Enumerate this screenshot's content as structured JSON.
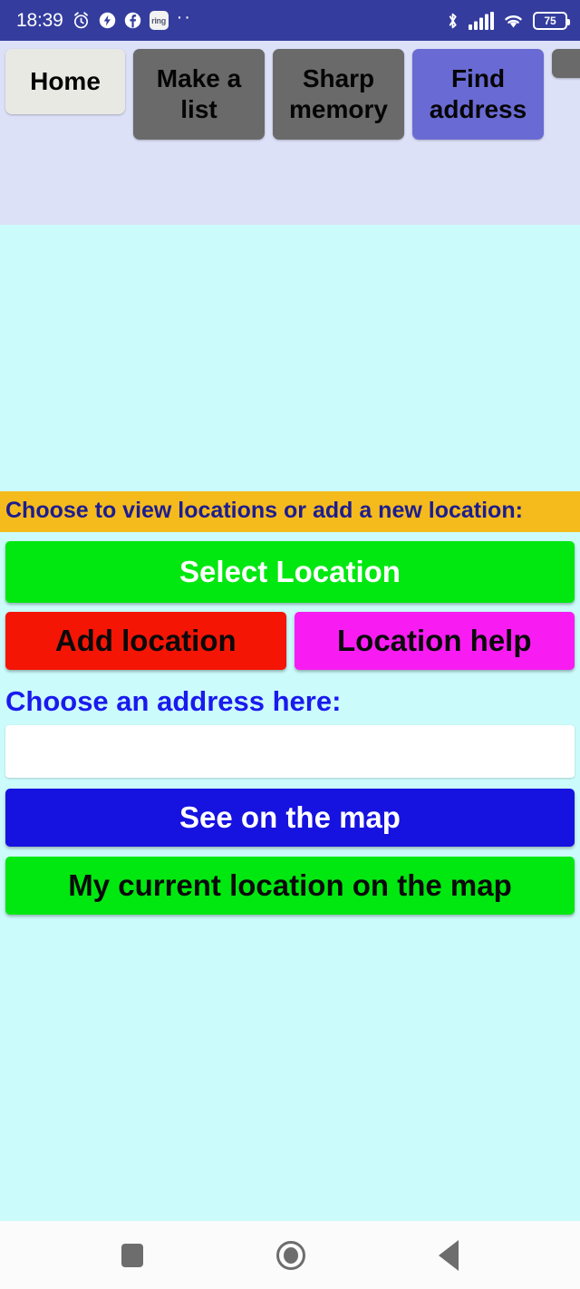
{
  "status_bar": {
    "time": "18:39",
    "left_icons": [
      {
        "name": "alarm-clock-icon"
      },
      {
        "name": "power-saver-bolt-icon"
      },
      {
        "name": "facebook-icon"
      },
      {
        "name": "ring-app-icon",
        "label": "ring"
      },
      {
        "name": "more-notifications-icon",
        "label": "··"
      }
    ],
    "right_icons": [
      {
        "name": "bluetooth-icon"
      },
      {
        "name": "cellular-signal-icon"
      },
      {
        "name": "wifi-icon"
      }
    ],
    "battery_level": "75",
    "background_color": "#343d9e"
  },
  "tabs": [
    {
      "label": "Home",
      "state": "inactive-light",
      "color": "#e9e9e4"
    },
    {
      "label": "Make  a list",
      "state": "inactive",
      "color": "#6a6a6a"
    },
    {
      "label": "Sharp memory",
      "state": "inactive",
      "color": "#6a6a6a"
    },
    {
      "label": "Find address",
      "state": "active",
      "color": "#6a6ad4"
    },
    {
      "label": "",
      "state": "inactive-partial",
      "color": "#6a6a6a"
    }
  ],
  "main": {
    "banner_text": "Choose to view locations or add a new location:",
    "banner_bg": "#f5bb1c",
    "banner_fg": "#1d1d8f",
    "select_location_label": "Select Location",
    "add_location_label": "Add location",
    "location_help_label": "Location help",
    "address_label": "Choose an address here:",
    "address_value": "",
    "address_placeholder": "",
    "see_on_map_label": "See on the map",
    "current_location_label": "My current location on the map",
    "background_color": "#ccfbfb"
  },
  "nav_bar": {
    "recents_name": "recents-square-icon",
    "home_name": "home-circle-icon",
    "back_name": "back-triangle-icon"
  }
}
